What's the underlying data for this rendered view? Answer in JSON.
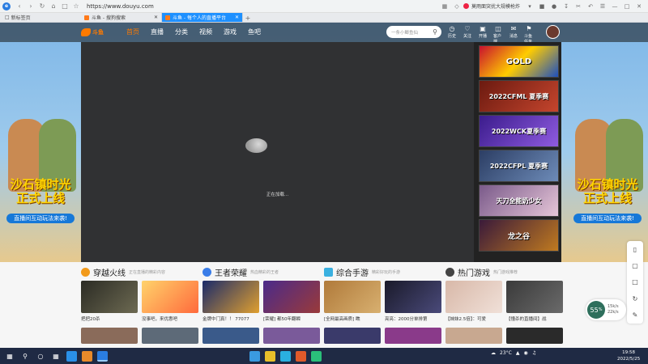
{
  "browser": {
    "url": "https://www.douyu.com",
    "news": "莫雨面突扰大规模枪炸",
    "bookmark": "新标签页",
    "tabs": [
      {
        "label": "斗鱼 - 搜狗搜索"
      },
      {
        "label": "斗鱼 - 每个人的直播平台"
      }
    ]
  },
  "site": {
    "logo": "斗鱼",
    "nav": [
      "首页",
      "直播",
      "分类",
      "视频",
      "游戏",
      "鱼吧"
    ],
    "search_placeholder": "一条小鲫鱼仙",
    "header_icons": [
      "历史",
      "关注",
      "开播",
      "客户端",
      "消息",
      "斗鱼任务"
    ],
    "side_title_line1": "沙石镇时光",
    "side_title_line2": "正式上线",
    "side_pill": "直播间互动玩法来袭!"
  },
  "player": {
    "loading_text": "正在加载..."
  },
  "playlist": [
    "GOLD",
    "2022CFML 夏季赛",
    "2022WCK夏季赛",
    "2022CFPL 夏季赛",
    "天刀全能奶少女",
    "龙之谷"
  ],
  "speed": {
    "value": "55",
    "unit": "%",
    "up": "15k/s",
    "down": "22k/s"
  },
  "sections": [
    {
      "name": "穿越火线",
      "sub": "正在直播的精彩内容",
      "cards": [
        {
          "title": "把把20杀"
        },
        {
          "title": "没事吧，来优惠吧"
        }
      ]
    },
    {
      "name": "王者荣耀",
      "sub": "热血精彩的王者",
      "cards": [
        {
          "title": "金牌中门真！！ 77077"
        },
        {
          "title": "[荣耀] 都50年翻瞬"
        }
      ]
    },
    {
      "name": "综合手游",
      "sub": "精彩好玩的手游",
      "cards": [
        {
          "title": "[全网最高画质] 瞧"
        },
        {
          "title": "亮亮：2000分单排第"
        }
      ]
    },
    {
      "name": "热门游戏",
      "sub": "热门游戏推荐",
      "cards": [
        {
          "title": "【妹妹2.5倍】：可爱"
        },
        {
          "title": "【懂杀的直播间】战"
        }
      ]
    }
  ],
  "taskbar": {
    "weather": "23°C",
    "time": "19:58",
    "date": "2022/5/25"
  },
  "colors": {
    "accent": "#ff7a00",
    "tab_active": "#1e90ff",
    "player_bg": "#303133",
    "taskbar": "#1f2a44"
  }
}
